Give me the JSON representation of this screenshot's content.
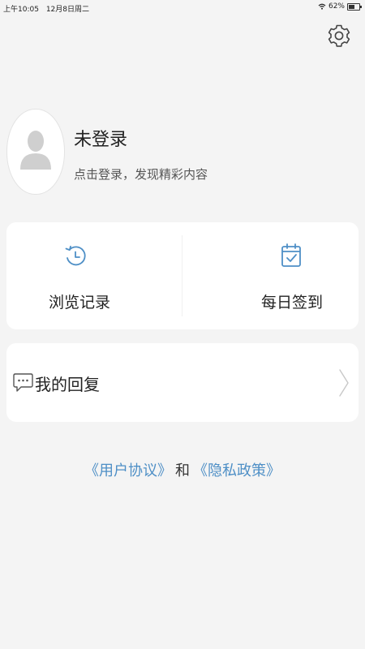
{
  "status_bar": {
    "time": "上午10:05",
    "date": "12月8日周二",
    "battery": "62%",
    "battery_level": 0.62,
    "wifi_icon": "wifi-icon",
    "battery_icon": "battery-icon"
  },
  "header": {
    "settings_icon": "gear-icon"
  },
  "profile": {
    "name": "未登录",
    "subtitle": "点击登录，发现精彩内容",
    "avatar_icon": "person-icon"
  },
  "quick_actions": [
    {
      "label": "浏览记录",
      "icon": "history-clock-icon"
    },
    {
      "label": "每日签到",
      "icon": "calendar-check-icon"
    }
  ],
  "menu": {
    "reply_label": "我的回复",
    "reply_icon": "chat-bubble-icon",
    "chevron_icon": "chevron-right-icon"
  },
  "legal": {
    "agreement": "《用户协议》",
    "and": "和",
    "privacy": "《隐私政策》"
  },
  "colors": {
    "accent": "#4e8fc6",
    "background": "#f4f4f4",
    "card": "#ffffff"
  }
}
